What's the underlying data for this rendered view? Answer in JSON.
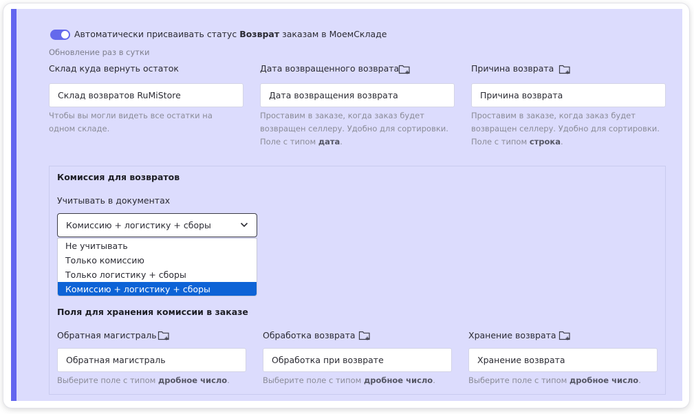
{
  "auto_status": {
    "enabled": true,
    "label_before": "Автоматически присваивать статус ",
    "label_bold": "Возврат",
    "label_after": " заказам в МоемСкладе",
    "update_note": "Обновление раз в сутки"
  },
  "fields": {
    "warehouse": {
      "label": "Склад куда вернуть остаток",
      "value": "Склад возвратов RuMiStore",
      "hint": "Чтобы вы могли видеть все остатки на одном складе."
    },
    "return_date": {
      "label": "Дата возвращенного возврата",
      "value": "Дата возвращения возврата",
      "hint_text": "Проставим в заказе, когда заказ будет возвращен селлеру. Удобно для сортировки. Поле с типом ",
      "hint_type": "дата",
      "hint_end": "."
    },
    "return_reason": {
      "label": "Причина возврата",
      "value": "Причина возврата",
      "hint_text": "Проставим в заказе, когда заказ будет возвращен селлеру. Удобно для сортировки. Поле с типом ",
      "hint_type": "строка",
      "hint_end": "."
    }
  },
  "commission": {
    "title": "Комиссия для возвратов",
    "account_label": "Учитывать в документах",
    "selected": "Комиссию + логистику + сборы",
    "options": [
      "Не учитывать",
      "Только комиссию",
      "Только логистику + сборы",
      "Комиссию + логистику + сборы"
    ],
    "storage_title": "Поля для хранения комиссии в заказе",
    "storage_fields": [
      {
        "label": "Обратная магистраль",
        "value": "Обратная магистраль"
      },
      {
        "label": "Обработка возврата",
        "value": "Обработка при возврате"
      },
      {
        "label": "Хранение возврата",
        "value": "Хранение возврата"
      }
    ],
    "hint_text": "Выберите поле с типом ",
    "hint_type": "дробное число",
    "hint_end": "."
  },
  "icons": {
    "folder": "folder-plus-icon",
    "chevron": "chevron-down-icon"
  },
  "colors": {
    "accent": "#6366ef",
    "panel": "#dcdcfd",
    "selected_option": "#0d63d6"
  }
}
